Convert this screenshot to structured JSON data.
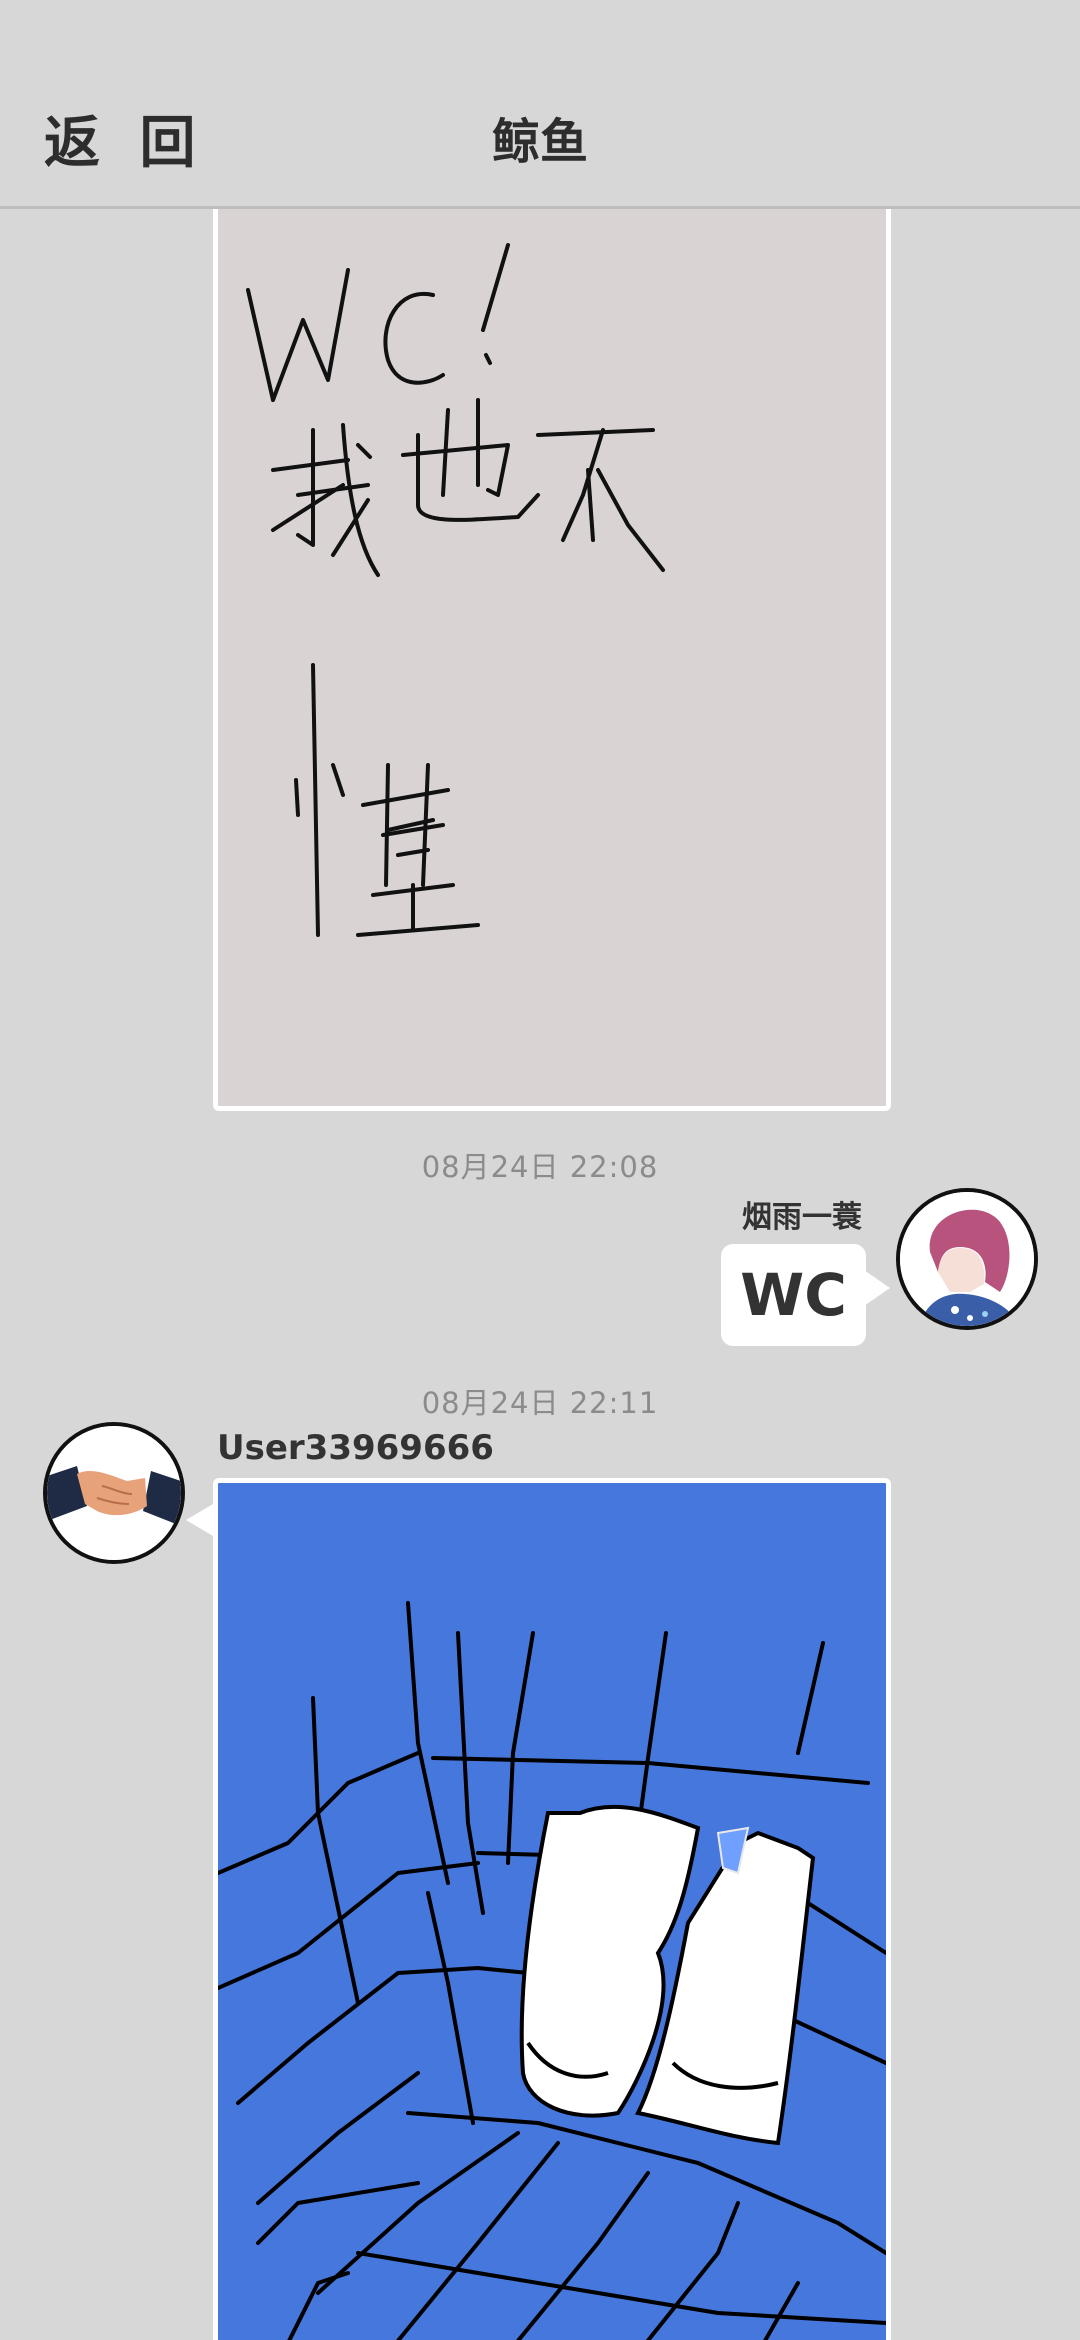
{
  "header": {
    "back_label": "返 回",
    "title": "鲸鱼"
  },
  "messages": [
    {
      "type": "drawing",
      "handwritten_text": "WC! 我也不懂"
    },
    {
      "type": "text",
      "timestamp": "08月24日  22:08",
      "sender": "烟雨一蓑",
      "text": "WC",
      "avatar_icon": "anime-avatar-icon"
    },
    {
      "type": "drawing",
      "timestamp": "08月24日  22:11",
      "sender": "User33969666",
      "avatar_icon": "handshake-avatar-icon"
    }
  ],
  "colors": {
    "background": "#d7d7d7",
    "drawing1_bg": "#dad3d4",
    "drawing2_bg": "#4677dc"
  }
}
